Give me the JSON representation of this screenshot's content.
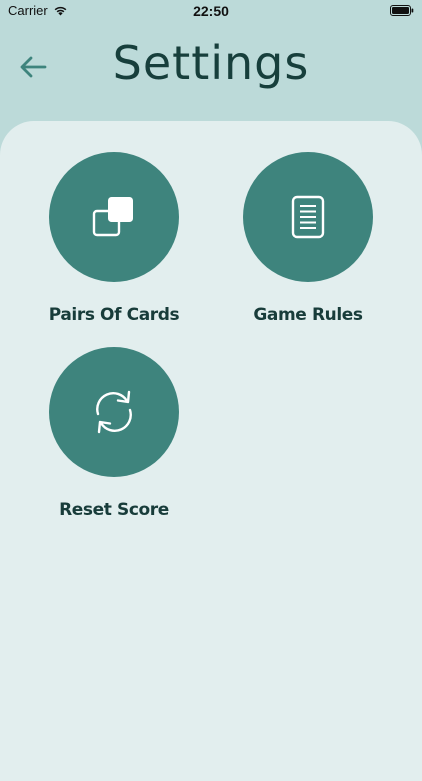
{
  "status_bar": {
    "carrier": "Carrier",
    "time": "22:50",
    "wifi_icon": "wifi-icon",
    "battery_icon": "battery-icon"
  },
  "header": {
    "title": "Settings",
    "back_icon": "arrow-left-icon"
  },
  "options": [
    {
      "label": "Pairs Of Cards",
      "icon": "overlapping-squares-icon"
    },
    {
      "label": "Game Rules",
      "icon": "document-lines-icon"
    },
    {
      "label": "Reset Score",
      "icon": "refresh-arrows-icon"
    }
  ],
  "colors": {
    "header_background": "#bcdad9",
    "panel_background": "#e2eeee",
    "accent": "#3e847d",
    "title_text": "#173f3c"
  }
}
